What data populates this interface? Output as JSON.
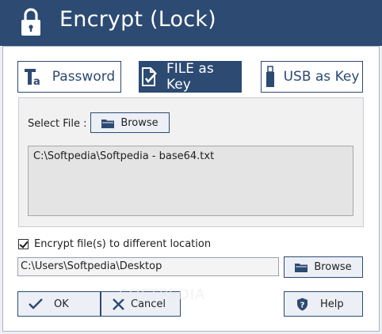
{
  "window": {
    "title": "Encrypt (Lock)",
    "title_color": "#ffffff",
    "title_bg": "#2c4a72"
  },
  "tabs": [
    {
      "label": "Password",
      "icon": "password-icon",
      "active": false
    },
    {
      "label": "FILE as Key",
      "icon": "file-key-icon",
      "active": true
    },
    {
      "label": "USB as Key",
      "icon": "usb-icon",
      "active": false
    }
  ],
  "file_panel": {
    "select_label": "Select File :",
    "browse_label": "Browse",
    "file_path": "C:\\Softpedia\\Softpedia - base64.txt"
  },
  "destination": {
    "checkbox_label": "Encrypt file(s) to different location",
    "checked": true,
    "path_value": "C:\\Users\\Softpedia\\Desktop",
    "browse_label": "Browse"
  },
  "footer": {
    "ok_label": "OK",
    "cancel_label": "Cancel",
    "help_label": "Help"
  },
  "watermark": "SOFTPEDIA",
  "colors": {
    "accent": "#2c4a72",
    "button_bg": "#ecf0f6",
    "panel_bg": "#f1f1f1"
  }
}
